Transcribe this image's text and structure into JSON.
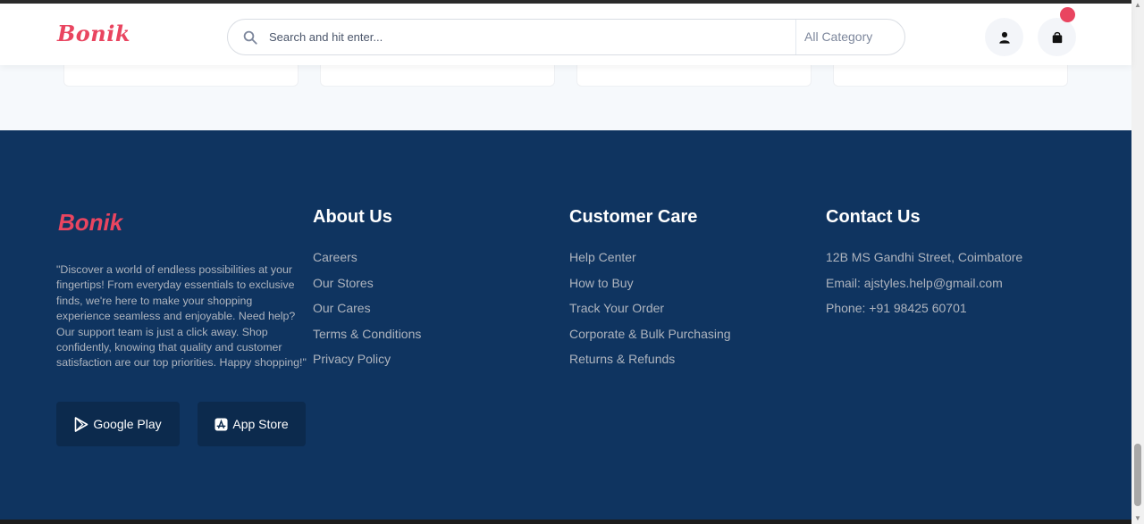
{
  "header": {
    "logo": "Bonik",
    "search_placeholder": "Search and hit enter...",
    "category_label": "All Category"
  },
  "footer": {
    "logo": "Bonik",
    "description": "\"Discover a world of endless possibilities at your fingertips! From everyday essentials to exclusive finds, we're here to make your shopping experience seamless and enjoyable. Need help? Our support team is just a click away. Shop confidently, knowing that quality and customer satisfaction are our top priorities. Happy shopping!\"",
    "google_play": "Google Play",
    "app_store": "App Store",
    "about": {
      "title": "About Us",
      "links": [
        "Careers",
        "Our Stores",
        "Our Cares",
        "Terms & Conditions",
        "Privacy Policy"
      ]
    },
    "care": {
      "title": "Customer Care",
      "links": [
        "Help Center",
        "How to Buy",
        "Track Your Order",
        "Corporate & Bulk Purchasing",
        "Returns & Refunds"
      ]
    },
    "contact": {
      "title": "Contact Us",
      "lines": [
        "12B MS Gandhi Street, Coimbatore",
        "Email: ajstyles.help@gmail.com",
        "Phone: +91 98425 60701"
      ]
    }
  },
  "colors": {
    "brand": "#e94560",
    "footer_bg": "#0f3460",
    "store_button_bg": "#0c2a4d"
  }
}
